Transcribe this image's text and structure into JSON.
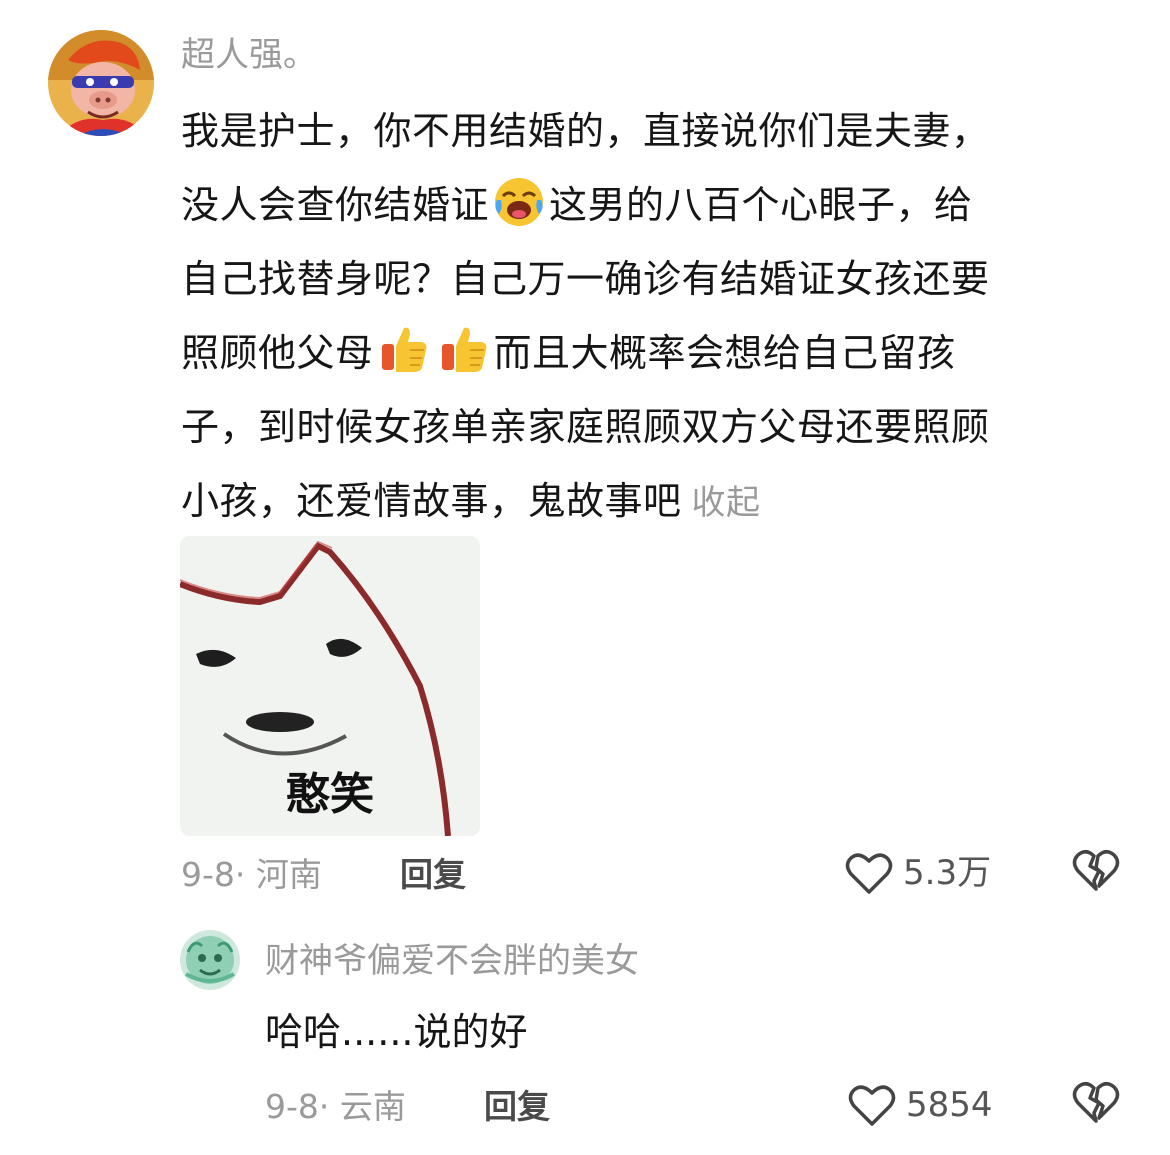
{
  "main_comment": {
    "username": "超人强。",
    "avatar_icon": "cartoon-pig-superhero-avatar",
    "lines": [
      "我是护士，你不用结婚的，直接说你们是夫妻，",
      "没人会查你结婚证",
      "这男的八百个心眼子，给",
      "自己找替身呢？自己万一确诊有结婚证女孩还要",
      "照顾他父母",
      "而且大概率会想给自己留孩",
      "子，到时候女孩单亲家庭照顾双方父母还要照顾",
      "小孩，还爱情故事，鬼故事吧"
    ],
    "collapse_label": "收起",
    "sticker_caption": "憨笑",
    "date_location": "9-8· 河南",
    "reply_label": "回复",
    "like_count": "5.3万"
  },
  "reply_comment": {
    "username": "财神爷偏爱不会胖的美女",
    "avatar_icon": "green-cartoon-avatar",
    "text": "哈哈......说的好",
    "date_location": "9-8· 云南",
    "reply_label": "回复",
    "like_count": "5854"
  },
  "colors": {
    "text_primary": "#161616",
    "text_secondary": "#9a9a9a",
    "reply_label": "#4a4a4a"
  }
}
